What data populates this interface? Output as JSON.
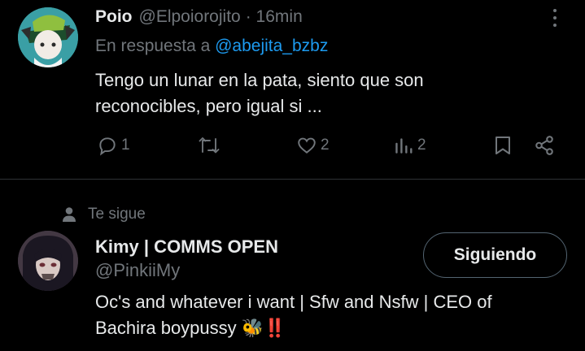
{
  "reply_tweet": {
    "author_name": "Poio",
    "author_handle": "@Elpoiorojito",
    "time": "· 16min",
    "reply_prefix": "En respuesta a",
    "reply_to": "@abejita_bzbz",
    "text_line1": "Tengo un lunar en la pata, siento que son",
    "text_line2": "reconocibles, pero igual si ...",
    "actions": {
      "replies": "1",
      "retweets": "",
      "likes": "2",
      "views": "2"
    }
  },
  "user_card": {
    "context": "Te sigue",
    "name": "Kimy | COMMS OPEN",
    "handle": "@PinkiiMy",
    "follow_button": "Siguiendo",
    "bio_line1": "Oc's and whatever i want | Sfw and Nsfw | CEO of",
    "bio_line2": "Bachira boypussy 🐝‼️"
  },
  "colors": {
    "background": "#000000",
    "text": "#e7e9ea",
    "muted": "#71767b",
    "link": "#1d9bf0",
    "divider": "#2f3336"
  }
}
